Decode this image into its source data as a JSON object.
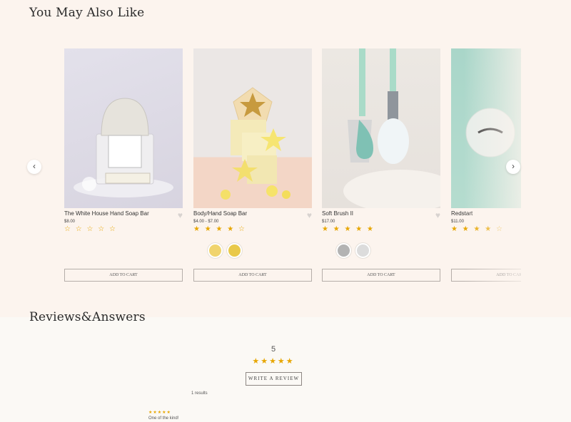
{
  "recommendations": {
    "title": "You May Also Like",
    "products": [
      {
        "name": "The White House Hand Soap Bar",
        "price": "$8.00",
        "stars": "☆ ☆ ☆ ☆ ☆",
        "rating": 0,
        "swatches": [],
        "button": "ADD TO CART"
      },
      {
        "name": "Body/Hand Soap Bar",
        "price": "$4.00 - $7.00",
        "stars": "★ ★ ★ ★ ☆",
        "rating": 4,
        "swatches": [
          "#f0d46e",
          "#e9c94a"
        ],
        "button": "ADD TO CART"
      },
      {
        "name": "Soft Brush II",
        "price": "$17.00",
        "stars": "★ ★ ★ ★ ★",
        "rating": 5,
        "swatches": [
          "#b3b3b3",
          "#dcdcdc"
        ],
        "button": "ADD TO CART"
      },
      {
        "name": "Redstart",
        "price": "$11.00",
        "stars": "★ ★ ★ ★ ☆",
        "rating": 4,
        "swatches": [],
        "button": "ADD TO CART"
      }
    ]
  },
  "reviews": {
    "title": "Reviews&Answers",
    "average": "5",
    "stars": "★★★★★",
    "write_button": "WRITE A REVIEW",
    "results": "1 results",
    "items": [
      {
        "stars": "★★★★★",
        "title": "One of the kind!"
      }
    ]
  },
  "colors": {
    "accent_star": "#e7a600",
    "background_top": "#fcf4ee",
    "background_bottom": "#fbf9f5"
  }
}
